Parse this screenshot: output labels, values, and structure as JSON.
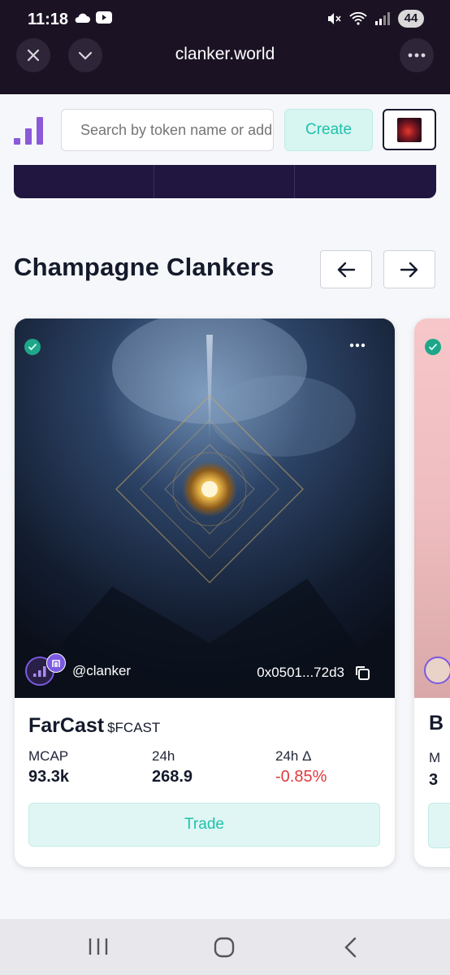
{
  "status_bar": {
    "time": "11:18",
    "battery": "44"
  },
  "browser": {
    "url": "clanker.world"
  },
  "header": {
    "search_placeholder": "Search by token name or address",
    "create_label": "Create"
  },
  "section": {
    "title": "Champagne Clankers"
  },
  "card": {
    "creator": "@clanker",
    "address": "0x0501...72d3",
    "name": "FarCast",
    "ticker": "$FCAST",
    "stats": [
      {
        "label": "MCAP",
        "value": "93.3k"
      },
      {
        "label": "24h",
        "value": "268.9"
      },
      {
        "label": "24h Δ",
        "value": "-0.85%"
      }
    ],
    "trade_label": "Trade"
  },
  "card2": {
    "name_initial": "B",
    "stat_label_initial": "M",
    "stat_value_initial": "3"
  },
  "colors": {
    "accent_teal": "#1fc1ac",
    "negative": "#e03a3e",
    "brand_purple": "#7a5ae0",
    "chrome_bg": "#1b1324"
  }
}
